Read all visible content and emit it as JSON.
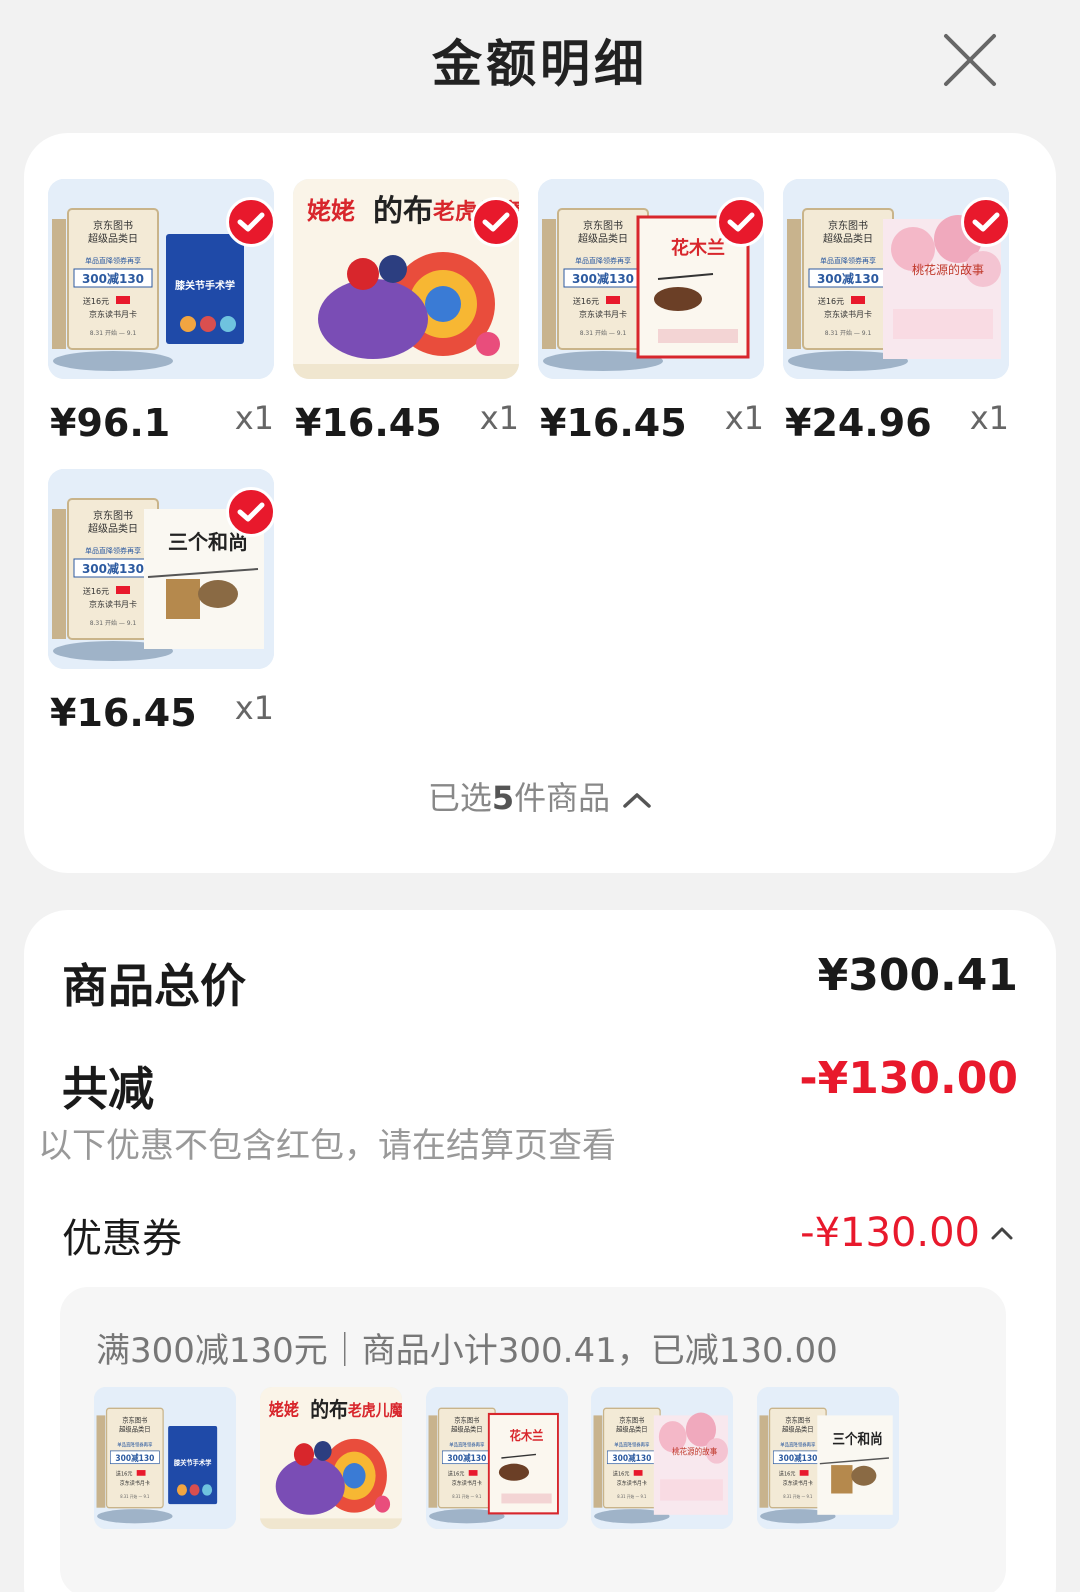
{
  "header": {
    "title": "金额明细"
  },
  "products": [
    {
      "price": "¥96.1",
      "qty": "x1",
      "cover": "jd-medical",
      "book_text": "膝关节手术学"
    },
    {
      "price": "¥16.45",
      "qty": "x1",
      "cover": "paper-cut",
      "book_text": "姥姥的布老虎儿魔法"
    },
    {
      "price": "¥16.45",
      "qty": "x1",
      "cover": "jd-mulan",
      "book_text": "花木兰"
    },
    {
      "price": "¥24.96",
      "qty": "x1",
      "cover": "jd-peach",
      "book_text": "桃花源的故事"
    },
    {
      "price": "¥16.45",
      "qty": "x1",
      "cover": "jd-monks",
      "book_text": "三个和尚"
    }
  ],
  "promo": {
    "line1": "京东图书",
    "line2": "超级品类日",
    "line3": "单品直降领券再享",
    "line4": "300减130",
    "line5": "送16元",
    "line6": "京东读书月卡",
    "line7": "8.31 开始 — 9.1"
  },
  "selected": {
    "prefix": "已选",
    "count": "5",
    "suffix": "件商品"
  },
  "summary": {
    "total_label": "商品总价",
    "total_value": "¥300.41",
    "reduce_label": "共减",
    "reduce_value": "-¥130.00",
    "note": "以下优惠不包含红包，请在结算页查看",
    "coupon_label": "优惠券",
    "coupon_value": "-¥130.00",
    "coupon_desc": "满300减130元｜商品小计300.41，已减130.00"
  },
  "colors": {
    "accent": "#e8192c",
    "background": "#f2f2f2"
  }
}
